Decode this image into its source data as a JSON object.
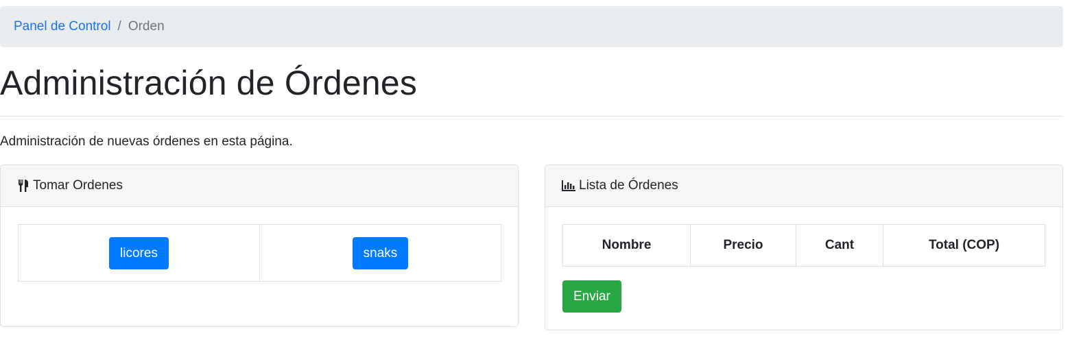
{
  "breadcrumb": {
    "home_label": "Panel de Control",
    "separator": "/",
    "current_label": "Orden"
  },
  "page": {
    "title": "Administración de Órdenes",
    "description": "Administración de nuevas órdenes en esta página."
  },
  "take_orders": {
    "icon": "utensils-icon",
    "title": "Tomar Ordenes",
    "categories": [
      "licores",
      "snaks"
    ]
  },
  "orders_list": {
    "icon": "bar-chart-icon",
    "title": "Lista de Órdenes",
    "columns": [
      "Nombre",
      "Precio",
      "Cant",
      "Total (COP)"
    ],
    "send_label": "Enviar"
  },
  "colors": {
    "primary": "#007bff",
    "success": "#28a745",
    "link": "#1a73e8",
    "breadcrumb_bg": "#e9ecef"
  }
}
